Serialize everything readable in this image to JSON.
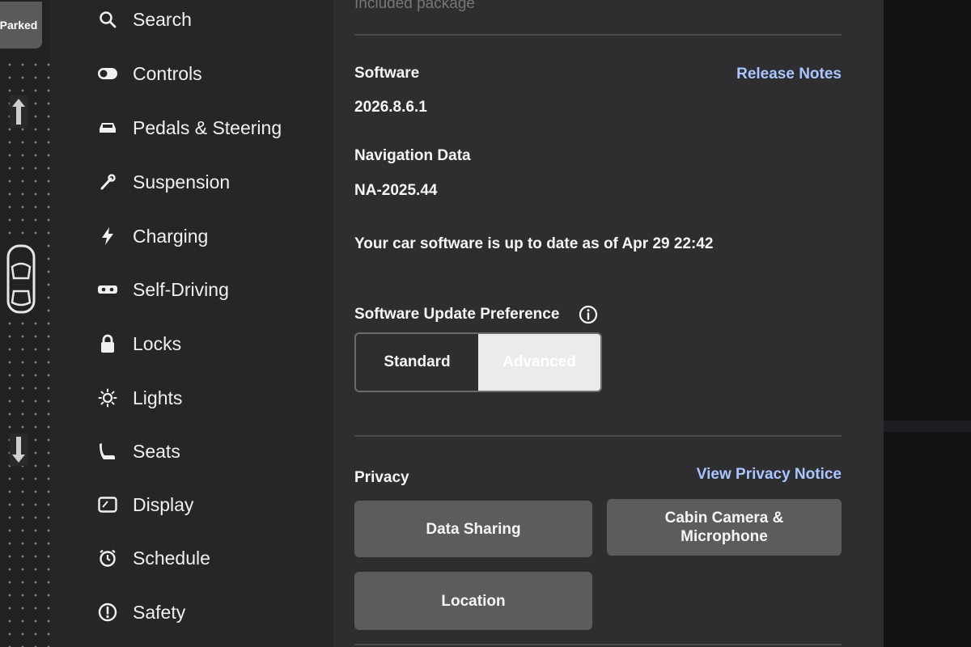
{
  "rail": {
    "status": "Parked"
  },
  "menu": {
    "items": [
      {
        "label": "Search",
        "icon": "search-icon"
      },
      {
        "label": "Controls",
        "icon": "toggle-icon"
      },
      {
        "label": "Pedals & Steering",
        "icon": "car-icon"
      },
      {
        "label": "Suspension",
        "icon": "wrench-icon"
      },
      {
        "label": "Charging",
        "icon": "bolt-icon"
      },
      {
        "label": "Self-Driving",
        "icon": "steering-icon"
      },
      {
        "label": "Locks",
        "icon": "lock-icon"
      },
      {
        "label": "Lights",
        "icon": "sun-icon"
      },
      {
        "label": "Seats",
        "icon": "seat-icon"
      },
      {
        "label": "Display",
        "icon": "display-icon"
      },
      {
        "label": "Schedule",
        "icon": "alarm-icon"
      },
      {
        "label": "Safety",
        "icon": "alert-icon"
      }
    ]
  },
  "content": {
    "top_faded": "Included package",
    "software": {
      "label": "Software",
      "version": "2026.8.6.1",
      "release_notes": "Release Notes"
    },
    "navigation": {
      "label": "Navigation Data",
      "version": "NA-2025.44"
    },
    "status_text": "Your car software is up to date as of Apr 29 22:42",
    "update_pref": {
      "label": "Software Update Preference",
      "options": [
        "Standard",
        "Advanced"
      ],
      "selected": "Advanced"
    },
    "privacy": {
      "label": "Privacy",
      "notice_link": "View Privacy Notice",
      "buttons": [
        "Data Sharing",
        "Cabin Camera & Microphone",
        "Location"
      ]
    }
  },
  "colors": {
    "link": "#a9c6ff",
    "selected_segment": "#ebebeb",
    "button_bg": "#5c5c5e"
  }
}
